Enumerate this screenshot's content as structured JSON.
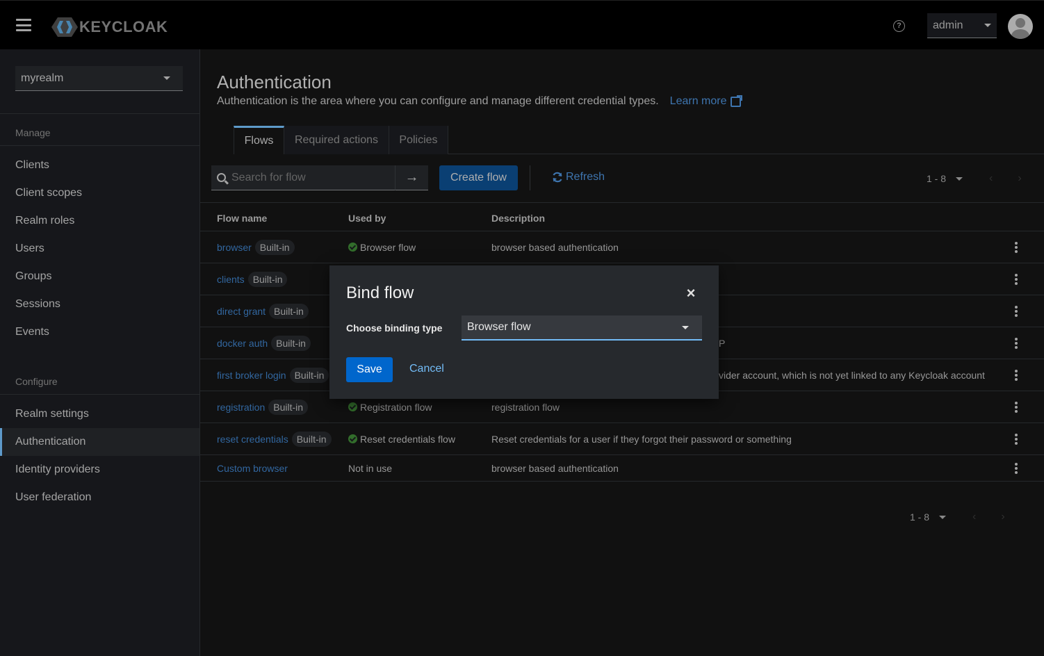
{
  "header": {
    "logo_text": "KEYCLOAK",
    "user": "admin"
  },
  "sidebar": {
    "realm": "myrealm",
    "manage_label": "Manage",
    "manage_items": [
      "Clients",
      "Client scopes",
      "Realm roles",
      "Users",
      "Groups",
      "Sessions",
      "Events"
    ],
    "configure_label": "Configure",
    "configure_items": [
      "Realm settings",
      "Authentication",
      "Identity providers",
      "User federation"
    ],
    "active_item": "Authentication"
  },
  "page": {
    "title": "Authentication",
    "description": "Authentication is the area where you can configure and manage different credential types.",
    "learn_more": "Learn more",
    "tabs": [
      "Flows",
      "Required actions",
      "Policies"
    ],
    "active_tab": "Flows"
  },
  "toolbar": {
    "search_placeholder": "Search for flow",
    "arrow": "→",
    "create_label": "Create flow",
    "refresh_label": "Refresh",
    "pagination": "1 - 8"
  },
  "table": {
    "columns": [
      "Flow name",
      "Used by",
      "Description"
    ],
    "rows": [
      {
        "name": "browser",
        "badge": "Built-in",
        "used_by": "Browser flow",
        "used_icon": true,
        "description": "browser based authentication"
      },
      {
        "name": "clients",
        "badge": "Built-in",
        "used_by": "",
        "used_icon": false,
        "description": ""
      },
      {
        "name": "direct grant",
        "badge": "Built-in",
        "used_by": "",
        "used_icon": false,
        "description": ""
      },
      {
        "name": "docker auth",
        "badge": "Built-in",
        "used_by": "",
        "used_icon": false,
        "description": "P"
      },
      {
        "name": "first broker login",
        "badge": "Built-in",
        "used_by": "",
        "used_icon": false,
        "description": "vider account, which is not yet linked to any Keycloak account"
      },
      {
        "name": "registration",
        "badge": "Built-in",
        "used_by": "Registration flow",
        "used_icon": true,
        "description": "registration flow"
      },
      {
        "name": "reset credentials",
        "badge": "Built-in",
        "used_by": "Reset credentials flow",
        "used_icon": true,
        "description": "Reset credentials for a user if they forgot their password or something"
      },
      {
        "name": "Custom browser",
        "badge": "",
        "used_by": "Not in use",
        "used_icon": false,
        "description": "browser based authentication"
      }
    ]
  },
  "footer": {
    "pagination": "1 - 8"
  },
  "modal": {
    "title": "Bind flow",
    "close": "×",
    "label": "Choose binding type",
    "selected": "Browser flow",
    "save_label": "Save",
    "cancel_label": "Cancel"
  },
  "colors": {
    "accent": "#73bcf7",
    "link": "#3d7ec4",
    "primary_button": "#0066cc",
    "success": "#3e8635"
  }
}
